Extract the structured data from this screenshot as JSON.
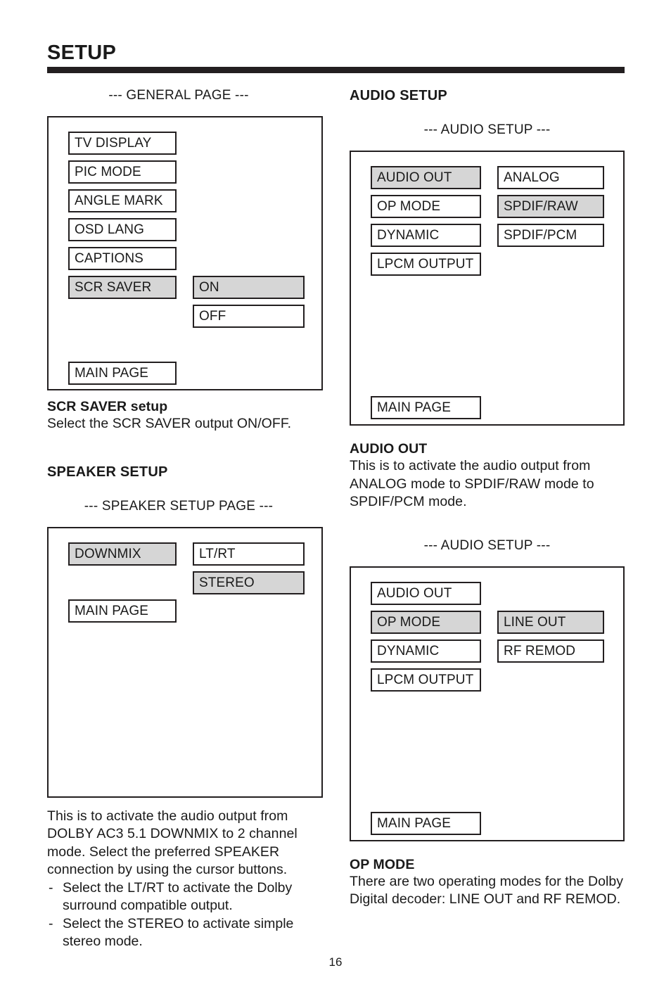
{
  "document": {
    "title": "SETUP",
    "page_number": "16"
  },
  "left_column": {
    "general": {
      "caption": "--- GENERAL PAGE ---",
      "menu_items": [
        {
          "label": "TV DISPLAY",
          "selected": false
        },
        {
          "label": "PIC MODE",
          "selected": false
        },
        {
          "label": "ANGLE MARK",
          "selected": false
        },
        {
          "label": "OSD LANG",
          "selected": false
        },
        {
          "label": "CAPTIONS",
          "selected": false
        },
        {
          "label": "SCR SAVER",
          "selected": true
        }
      ],
      "main_page_label": "MAIN PAGE",
      "option_items": [
        {
          "label": "ON",
          "selected": true
        },
        {
          "label": "OFF",
          "selected": false
        }
      ],
      "description_head_bold": "SCR SAVER",
      "description_head_rest": " setup",
      "description_text": "Select the SCR SAVER output ON/OFF."
    },
    "speaker": {
      "heading": "SPEAKER SETUP",
      "caption": "--- SPEAKER SETUP PAGE ---",
      "menu_items": [
        {
          "label": "DOWNMIX",
          "selected": true
        }
      ],
      "main_page_label": "MAIN PAGE",
      "option_items": [
        {
          "label": "LT/RT",
          "selected": false
        },
        {
          "label": "STEREO",
          "selected": true
        }
      ],
      "paragraph": "This is to activate the audio output from DOLBY AC3 5.1 DOWNMIX to 2 channel mode.  Select the preferred SPEAKER connection by using the cursor buttons.",
      "bullets": [
        "Select the LT/RT to activate the Dolby surround compatible output.",
        "Select the STEREO to activate simple stereo mode."
      ]
    }
  },
  "right_column": {
    "audio_setup": {
      "heading": "AUDIO SETUP",
      "caption_1": "--- AUDIO SETUP ---",
      "screen_1": {
        "menu_items": [
          {
            "label": "AUDIO OUT",
            "selected": true
          },
          {
            "label": "OP MODE",
            "selected": false
          },
          {
            "label": "DYNAMIC",
            "selected": false
          },
          {
            "label": "LPCM OUTPUT",
            "selected": false
          }
        ],
        "main_page_label": "MAIN PAGE",
        "option_items": [
          {
            "label": "ANALOG",
            "selected": false
          },
          {
            "label": "SPDIF/RAW",
            "selected": true
          },
          {
            "label": "SPDIF/PCM",
            "selected": false
          }
        ]
      },
      "audio_out_head": "AUDIO OUT",
      "audio_out_text": "This is to activate the audio output from ANALOG mode to SPDIF/RAW mode to SPDIF/PCM mode.",
      "caption_2": "--- AUDIO SETUP ---",
      "screen_2": {
        "menu_items": [
          {
            "label": "AUDIO OUT",
            "selected": false
          },
          {
            "label": "OP MODE",
            "selected": true
          },
          {
            "label": "DYNAMIC",
            "selected": false
          },
          {
            "label": "LPCM OUTPUT",
            "selected": false
          }
        ],
        "main_page_label": "MAIN PAGE",
        "option_items": [
          {
            "label": "LINE OUT",
            "selected": true
          },
          {
            "label": "RF REMOD",
            "selected": false
          }
        ]
      },
      "op_mode_head": "OP MODE",
      "op_mode_text": "There are two operating modes for the Dolby Digital decoder:  LINE OUT and RF REMOD."
    }
  },
  "colors": {
    "ink": "#231f20",
    "highlight": "#d6d6d6",
    "background": "#ffffff"
  }
}
